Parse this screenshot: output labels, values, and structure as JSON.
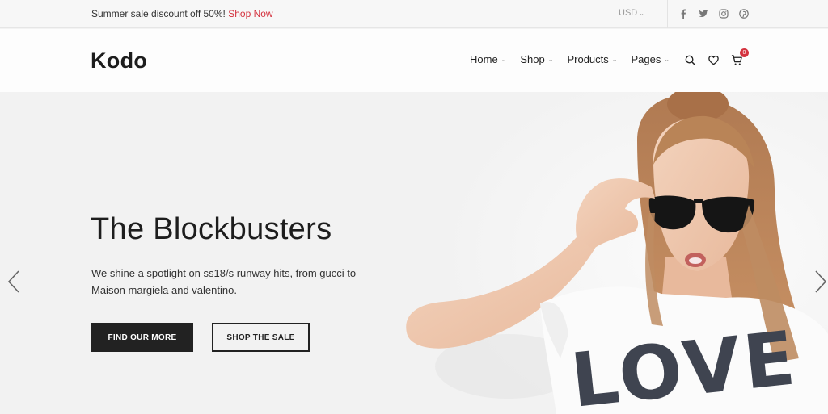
{
  "topbar": {
    "promo_text": "Summer sale discount off 50%!",
    "promo_link": "Shop Now",
    "currency": "USD",
    "socials": [
      "facebook-icon",
      "twitter-icon",
      "instagram-icon",
      "pinterest-icon"
    ]
  },
  "header": {
    "logo": "Kodo",
    "nav": [
      {
        "label": "Home"
      },
      {
        "label": "Shop"
      },
      {
        "label": "Products"
      },
      {
        "label": "Pages"
      }
    ],
    "cart_count": "0"
  },
  "hero": {
    "title": "The Blockbusters",
    "description": "We shine a spotlight on ss18/s runway hits, from gucci to Maison margiela and valentino.",
    "primary_button": "FIND OUR MORE",
    "secondary_button": "SHOP THE SALE",
    "shirt_text": "LOVE"
  },
  "colors": {
    "accent": "#d4333f",
    "dark": "#222222",
    "hero_bg": "#f2f2f2"
  }
}
